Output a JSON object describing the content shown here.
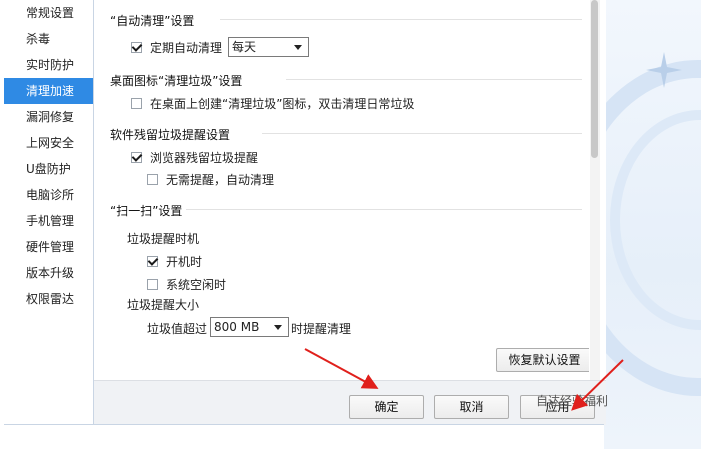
{
  "sidebar": {
    "items": [
      {
        "label": "常规设置"
      },
      {
        "label": "杀毒"
      },
      {
        "label": "实时防护"
      },
      {
        "label": "清理加速"
      },
      {
        "label": "漏洞修复"
      },
      {
        "label": "上网安全"
      },
      {
        "label": "U盘防护"
      },
      {
        "label": "电脑诊所"
      },
      {
        "label": "手机管理"
      },
      {
        "label": "硬件管理"
      },
      {
        "label": "版本升级"
      },
      {
        "label": "权限雷达"
      }
    ],
    "active_index": 3
  },
  "auto_clean": {
    "title": "“自动清理”设置",
    "checkbox_label": "定期自动清理",
    "checked": true,
    "frequency_value": "每天"
  },
  "desktop_icon": {
    "title": "桌面图标“清理垃圾”设置",
    "checkbox_label": "在桌面上创建“清理垃圾”图标，双击清理日常垃圾",
    "checked": false
  },
  "residual": {
    "title": "软件残留垃圾提醒设置",
    "browser_label": "浏览器残留垃圾提醒",
    "browser_checked": true,
    "auto_label": "无需提醒，自动清理",
    "auto_checked": false
  },
  "scan": {
    "title": "“扫一扫”设置",
    "timing_label": "垃圾提醒时机",
    "boot_label": "开机时",
    "boot_checked": true,
    "idle_label": "系统空闲时",
    "idle_checked": false,
    "size_label": "垃圾提醒大小",
    "threshold_prefix": "垃圾值超过",
    "threshold_value": "800 MB",
    "threshold_suffix": "时提醒清理"
  },
  "buttons": {
    "restore_defaults": "恢复默认设置",
    "ok": "确定",
    "cancel": "取消",
    "apply": "应用"
  },
  "watermark": "自达经验福利",
  "colors": {
    "accent": "#2f8ae4",
    "annotation_arrow": "#e0201c"
  }
}
